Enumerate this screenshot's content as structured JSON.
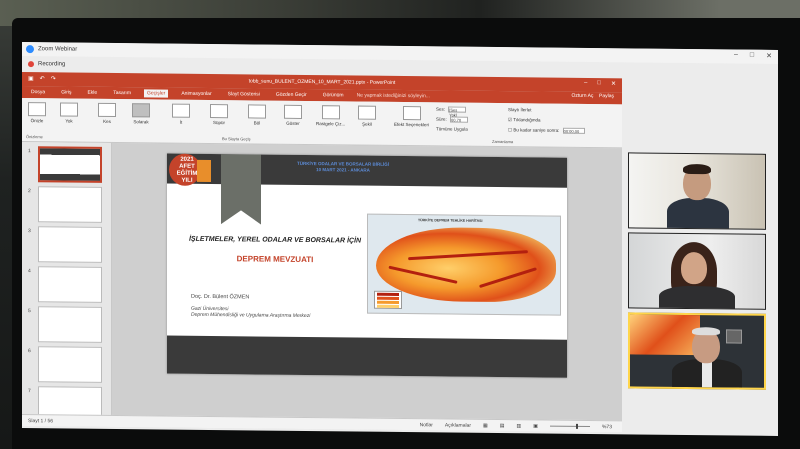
{
  "zoom": {
    "title": "Zoom Webinar",
    "recording_label": "Recording",
    "window_controls": [
      "–",
      "□",
      "✕"
    ]
  },
  "powerpoint": {
    "window_title": "tobb_sunu_BULENT_OZMEN_10_MART_2021.pptx - PowerPoint",
    "user": "Ozturn Aç",
    "share_label": "Paylaş",
    "tabs": [
      "Dosya",
      "Giriş",
      "Ekle",
      "Tasarım",
      "Geçişler",
      "Animasyonlar",
      "Slayt Gösterisi",
      "Gözden Geçir",
      "Görünüm"
    ],
    "active_tab": "Geçişler",
    "tell_me": "Ne yapmak istediğinizi söyleyin...",
    "ribbon_buttons": [
      "Önizle",
      "Yok",
      "Kes",
      "Solarak",
      "İt",
      "Süpür",
      "Böl",
      "Göster",
      "Rastgele Çiz...",
      "Şekil",
      "Efekt Seçenekleri"
    ],
    "selected_transition": "Solarak",
    "group_labels": {
      "preview": "Önizleme",
      "transition": "Bu Slayta Geçiş",
      "timing": "Zamanlama"
    },
    "timing": {
      "sound_label": "Ses:",
      "sound_value": "[Ses Yok]",
      "duration_label": "Süre:",
      "duration_value": "00,70",
      "apply_all": "Tümüne Uygula",
      "advance_label": "Slaytı İlerlet",
      "on_click": "Tıklandığında",
      "after_label": "Bu kadar saniye sonra:",
      "after_value": "00:00,00"
    },
    "status": {
      "slide_info": "Slayt 1 / 56",
      "notes": "Notlar",
      "comments": "Açıklamalar",
      "zoom_level": "%73"
    },
    "slide_numbers": [
      "1",
      "2",
      "3",
      "4",
      "5",
      "6",
      "7"
    ]
  },
  "slide": {
    "logo_text": "2021 AFET EĞİTİM YILI",
    "event_line1": "TÜRKİYE ODALAR VE BORSALAR BİRLİĞİ",
    "event_line2": "10 MART 2021 - ANKARA",
    "headline": "İŞLETMELER, YEREL ODALAR VE BORSALAR İÇİN",
    "title": "DEPREM MEVZUATI",
    "author": "Doç. Dr. Bülent ÖZMEN",
    "affiliation_line1": "Gazi Üniversitesi",
    "affiliation_line2": "Deprem Mühendisliği ve Uygulama Araştırma Merkezi",
    "map_title": "TÜRKİYE DEPREM TEHLİKE HARİTASI"
  },
  "colors": {
    "ppt_accent": "#c4432a",
    "slide_dark": "#3a3a3a",
    "active_speaker": "#ffd54a"
  },
  "participants": [
    {
      "role": "male participant"
    },
    {
      "role": "female participant"
    },
    {
      "role": "speaker"
    }
  ]
}
